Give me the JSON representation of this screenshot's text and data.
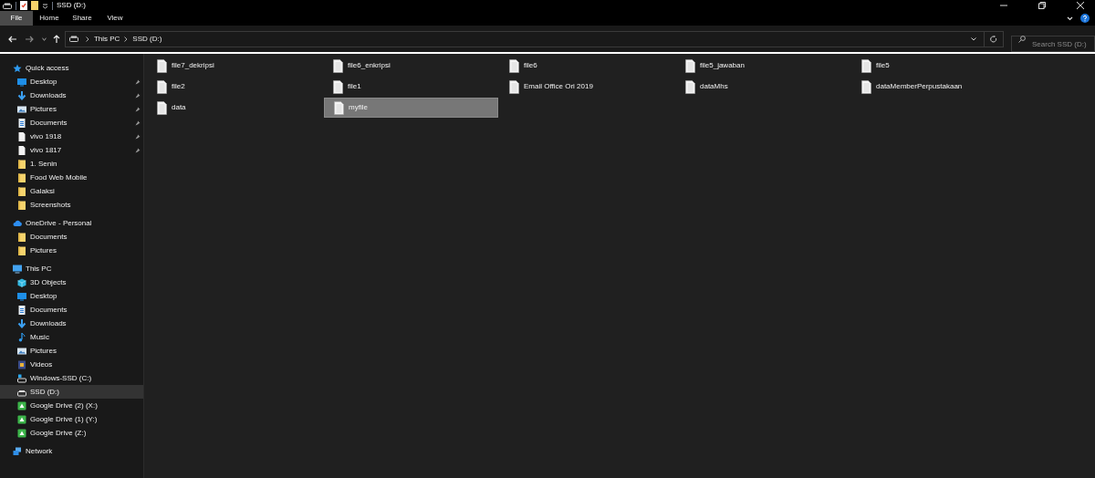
{
  "window": {
    "title": "SSD (D:)"
  },
  "ribbon_tabs": [
    {
      "label": "File",
      "selected": true
    },
    {
      "label": "Home",
      "selected": false
    },
    {
      "label": "Share",
      "selected": false
    },
    {
      "label": "View",
      "selected": false
    }
  ],
  "address": {
    "path": [
      "This PC",
      "SSD (D:)"
    ]
  },
  "search": {
    "placeholder": "Search SSD (D:)"
  },
  "sidebar": [
    {
      "label": "Quick access",
      "kind": "star",
      "selected": false,
      "children": [
        {
          "label": "Desktop",
          "kind": "desktop",
          "pinned": true,
          "selected": false
        },
        {
          "label": "Downloads",
          "kind": "download",
          "pinned": true,
          "selected": false
        },
        {
          "label": "Pictures",
          "kind": "pictures",
          "pinned": true,
          "selected": false
        },
        {
          "label": "Documents",
          "kind": "documents",
          "pinned": true,
          "selected": false
        },
        {
          "label": "vivo 1918",
          "kind": "file",
          "pinned": true,
          "selected": false
        },
        {
          "label": "vivo 1817",
          "kind": "file",
          "pinned": true,
          "selected": false
        },
        {
          "label": "1. Senin",
          "kind": "folder",
          "pinned": false,
          "selected": false
        },
        {
          "label": "Food Web Mobile",
          "kind": "folder",
          "pinned": false,
          "selected": false
        },
        {
          "label": "Galaksi",
          "kind": "folder",
          "pinned": false,
          "selected": false
        },
        {
          "label": "Screenshots",
          "kind": "folder",
          "pinned": false,
          "selected": false
        }
      ]
    },
    {
      "label": "OneDrive - Personal",
      "kind": "cloud",
      "selected": false,
      "children": [
        {
          "label": "Documents",
          "kind": "folder",
          "pinned": false,
          "selected": false
        },
        {
          "label": "Pictures",
          "kind": "folder",
          "pinned": false,
          "selected": false
        }
      ]
    },
    {
      "label": "This PC",
      "kind": "pc",
      "selected": false,
      "children": [
        {
          "label": "3D Objects",
          "kind": "cube",
          "pinned": false,
          "selected": false
        },
        {
          "label": "Desktop",
          "kind": "desktop",
          "pinned": false,
          "selected": false
        },
        {
          "label": "Documents",
          "kind": "documents",
          "pinned": false,
          "selected": false
        },
        {
          "label": "Downloads",
          "kind": "download",
          "pinned": false,
          "selected": false
        },
        {
          "label": "Music",
          "kind": "music",
          "pinned": false,
          "selected": false
        },
        {
          "label": "Pictures",
          "kind": "pictures",
          "pinned": false,
          "selected": false
        },
        {
          "label": "Videos",
          "kind": "videos",
          "pinned": false,
          "selected": false
        },
        {
          "label": "Windows-SSD (C:)",
          "kind": "windrive",
          "pinned": false,
          "selected": false
        },
        {
          "label": "SSD (D:)",
          "kind": "drive",
          "pinned": false,
          "selected": true
        },
        {
          "label": "Google Drive (2) (X:)",
          "kind": "gdrive",
          "pinned": false,
          "selected": false
        },
        {
          "label": "Google Drive (1) (Y:)",
          "kind": "gdrive",
          "pinned": false,
          "selected": false
        },
        {
          "label": "Google Drive (Z:)",
          "kind": "gdrive",
          "pinned": false,
          "selected": false
        }
      ]
    },
    {
      "label": "Network",
      "kind": "network",
      "selected": false
    }
  ],
  "files": [
    {
      "name": "file7_dekripsi",
      "selected": false
    },
    {
      "name": "file6_enkripsi",
      "selected": false
    },
    {
      "name": "file6",
      "selected": false
    },
    {
      "name": "file5_jawaban",
      "selected": false
    },
    {
      "name": "file5",
      "selected": false
    },
    {
      "name": "file2",
      "selected": false
    },
    {
      "name": "file1",
      "selected": false
    },
    {
      "name": "Email Office Ori 2019",
      "selected": false
    },
    {
      "name": "dataMhs",
      "selected": false
    },
    {
      "name": "dataMemberPerpustakaan",
      "selected": false
    },
    {
      "name": "data",
      "selected": false
    },
    {
      "name": "myfile",
      "selected": true
    }
  ]
}
